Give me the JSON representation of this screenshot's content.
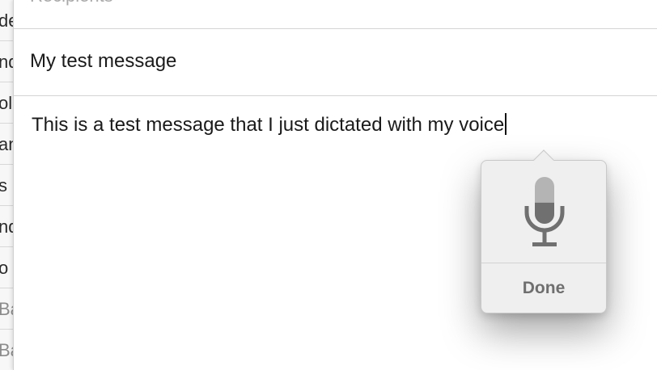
{
  "mail_list": {
    "rows": [
      {
        "fragment": "de",
        "dim": false
      },
      {
        "fragment": "nd",
        "dim": false
      },
      {
        "fragment": "oli",
        "dim": false
      },
      {
        "fragment": "an",
        "dim": false
      },
      {
        "fragment": "s S",
        "dim": false
      },
      {
        "fragment": "nd",
        "dim": false
      },
      {
        "fragment": "o c",
        "dim": false
      },
      {
        "fragment": "Ba",
        "dim": true
      },
      {
        "fragment": "Ba",
        "dim": true
      }
    ]
  },
  "compose": {
    "recipients_placeholder": "Recipients",
    "subject": "My test message",
    "body": "This is a test message that I just dictated with my voice"
  },
  "dictation": {
    "icon": "microphone-icon",
    "input_level": 0.45,
    "done_label": "Done"
  }
}
